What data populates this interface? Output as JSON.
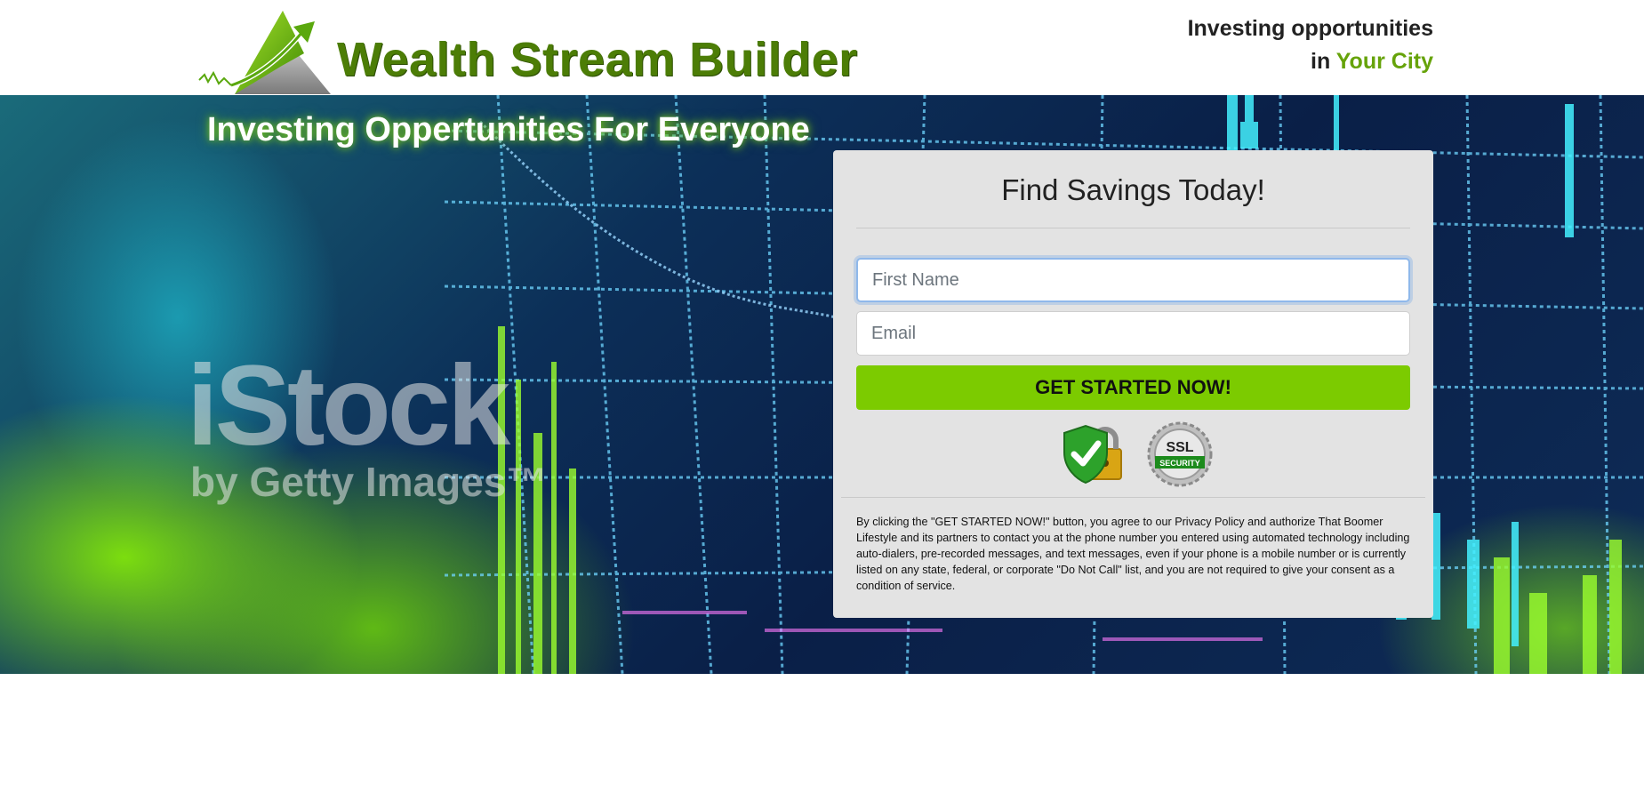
{
  "header": {
    "brand_name": "Wealth Stream Builder",
    "tagline_line1": "Investing opportunities",
    "tagline_in": "in",
    "tagline_city": "Your City"
  },
  "hero": {
    "title": "Investing Oppertunities For Everyone",
    "watermark_line1": "iStock",
    "watermark_line2": "by Getty Images™"
  },
  "form": {
    "title": "Find Savings Today!",
    "first_name_placeholder": "First Name",
    "email_placeholder": "Email",
    "submit_label": "GET STARTED NOW!",
    "ssl_badge_text_1": "SSL",
    "ssl_badge_text_2": "SECURITY",
    "disclaimer": "By clicking the \"GET STARTED NOW!\" button, you agree to our Privacy Policy and authorize That Boomer Lifestyle and its partners to contact you at the phone number you entered using automated technology including auto-dialers, pre-recorded messages, and text messages, even if your phone is a mobile number or is currently listed on any state, federal, or corporate \"Do Not Call\" list, and you are not required to give your consent as a condition of service."
  },
  "colors": {
    "brand_green": "#4c7d06",
    "accent_green": "#66a30a",
    "button_green": "#7ccb00",
    "card_bg": "#e3e3e3"
  },
  "icons": [
    "mountain-arrow-logo-icon",
    "shield-check-icon",
    "padlock-icon",
    "ssl-security-badge-icon"
  ]
}
